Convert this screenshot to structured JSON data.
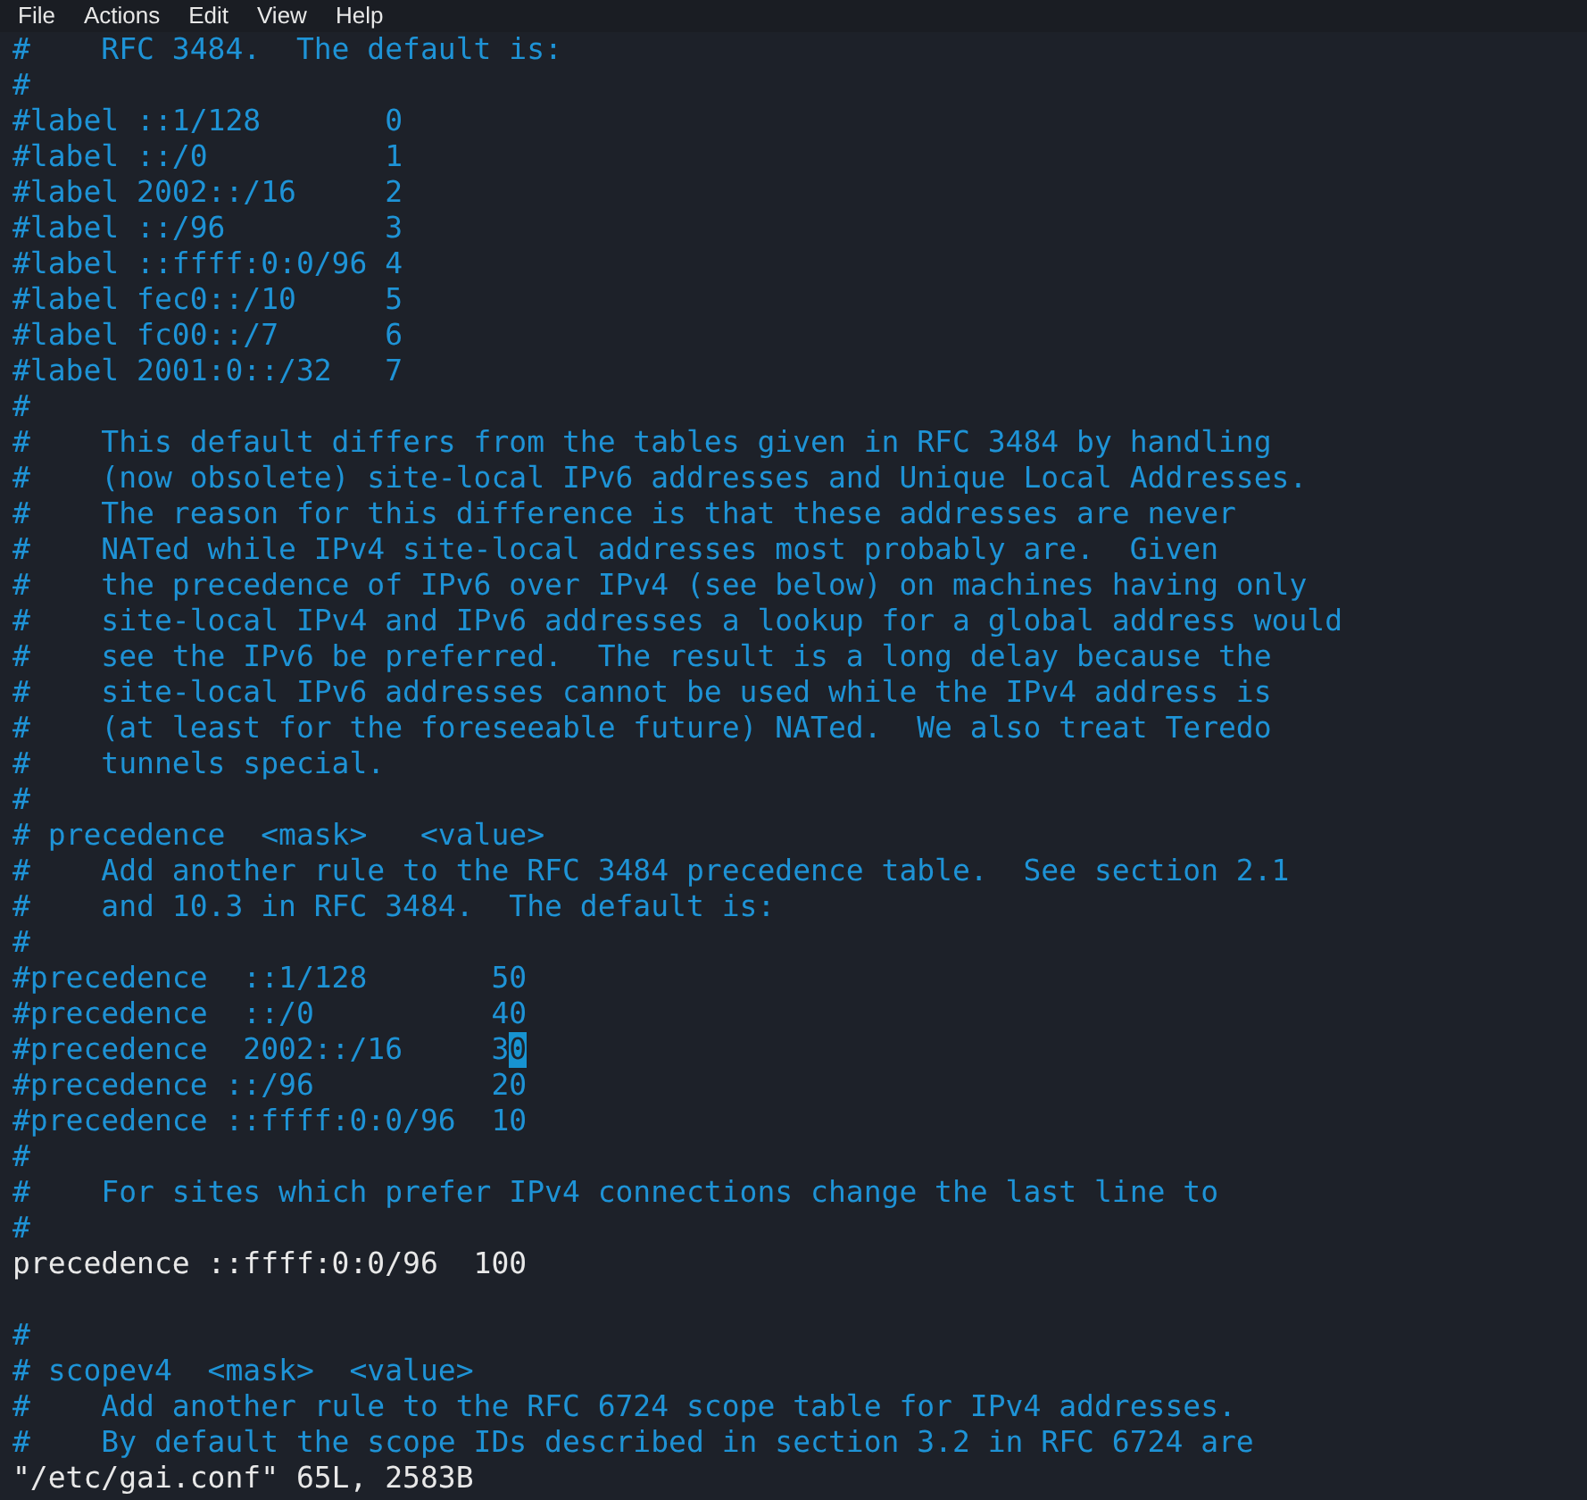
{
  "menu_bar": [
    "File",
    "Actions",
    "Edit",
    "View",
    "Help"
  ],
  "lines": [
    {
      "kind": "comment",
      "text": "#    RFC 3484.  The default is:"
    },
    {
      "kind": "comment",
      "text": "#"
    },
    {
      "kind": "comment",
      "text": "#label ::1/128       0"
    },
    {
      "kind": "comment",
      "text": "#label ::/0          1"
    },
    {
      "kind": "comment",
      "text": "#label 2002::/16     2"
    },
    {
      "kind": "comment",
      "text": "#label ::/96         3"
    },
    {
      "kind": "comment",
      "text": "#label ::ffff:0:0/96 4"
    },
    {
      "kind": "comment",
      "text": "#label fec0::/10     5"
    },
    {
      "kind": "comment",
      "text": "#label fc00::/7      6"
    },
    {
      "kind": "comment",
      "text": "#label 2001:0::/32   7"
    },
    {
      "kind": "comment",
      "text": "#"
    },
    {
      "kind": "comment",
      "text": "#    This default differs from the tables given in RFC 3484 by handling"
    },
    {
      "kind": "comment",
      "text": "#    (now obsolete) site-local IPv6 addresses and Unique Local Addresses."
    },
    {
      "kind": "comment",
      "text": "#    The reason for this difference is that these addresses are never"
    },
    {
      "kind": "comment",
      "text": "#    NATed while IPv4 site-local addresses most probably are.  Given"
    },
    {
      "kind": "comment",
      "text": "#    the precedence of IPv6 over IPv4 (see below) on machines having only"
    },
    {
      "kind": "comment",
      "text": "#    site-local IPv4 and IPv6 addresses a lookup for a global address would"
    },
    {
      "kind": "comment",
      "text": "#    see the IPv6 be preferred.  The result is a long delay because the"
    },
    {
      "kind": "comment",
      "text": "#    site-local IPv6 addresses cannot be used while the IPv4 address is"
    },
    {
      "kind": "comment",
      "text": "#    (at least for the foreseeable future) NATed.  We also treat Teredo"
    },
    {
      "kind": "comment",
      "text": "#    tunnels special."
    },
    {
      "kind": "comment",
      "text": "#"
    },
    {
      "kind": "comment",
      "text": "# precedence  <mask>   <value>"
    },
    {
      "kind": "comment",
      "text": "#    Add another rule to the RFC 3484 precedence table.  See section 2.1"
    },
    {
      "kind": "comment",
      "text": "#    and 10.3 in RFC 3484.  The default is:"
    },
    {
      "kind": "comment",
      "text": "#"
    },
    {
      "kind": "comment",
      "text": "#precedence  ::1/128       50"
    },
    {
      "kind": "comment",
      "text": "#precedence  ::/0          40"
    },
    {
      "kind": "comment",
      "text": "#precedence  2002::/16     3",
      "cursor": "0"
    },
    {
      "kind": "comment",
      "text": "#precedence ::/96          20"
    },
    {
      "kind": "comment",
      "text": "#precedence ::ffff:0:0/96  10"
    },
    {
      "kind": "comment",
      "text": "#"
    },
    {
      "kind": "comment",
      "text": "#    For sites which prefer IPv4 connections change the last line to"
    },
    {
      "kind": "comment",
      "text": "#"
    },
    {
      "kind": "normal",
      "text": "precedence ::ffff:0:0/96  100"
    },
    {
      "kind": "blank"
    },
    {
      "kind": "comment",
      "text": "#"
    },
    {
      "kind": "comment",
      "text": "# scopev4  <mask>  <value>"
    },
    {
      "kind": "comment",
      "text": "#    Add another rule to the RFC 6724 scope table for IPv4 addresses."
    },
    {
      "kind": "comment",
      "text": "#    By default the scope IDs described in section 3.2 in RFC 6724 are"
    }
  ],
  "status_line": "\"/etc/gai.conf\" 65L, 2583B"
}
